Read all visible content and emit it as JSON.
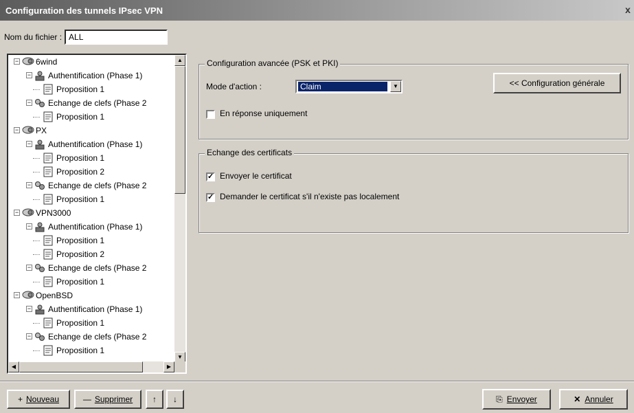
{
  "window": {
    "title": "Configuration des tunnels IPsec VPN",
    "close_glyph": "x"
  },
  "file": {
    "label": "Nom du fichier :",
    "value": "ALL"
  },
  "tree": {
    "items": [
      {
        "level": 0,
        "icon": "tunnel-icon",
        "label": "6wind"
      },
      {
        "level": 1,
        "icon": "auth-icon",
        "label": "Authentification (Phase 1)"
      },
      {
        "level": 2,
        "icon": "proposal-icon",
        "label": "Proposition 1"
      },
      {
        "level": 1,
        "icon": "key-exchange-icon",
        "label": "Echange de clefs (Phase 2"
      },
      {
        "level": 2,
        "icon": "proposal-icon",
        "label": "Proposition 1"
      },
      {
        "level": 0,
        "icon": "tunnel-icon",
        "label": "PX"
      },
      {
        "level": 1,
        "icon": "auth-icon",
        "label": "Authentification (Phase 1)"
      },
      {
        "level": 2,
        "icon": "proposal-icon",
        "label": "Proposition 1"
      },
      {
        "level": 2,
        "icon": "proposal-icon",
        "label": "Proposition 2"
      },
      {
        "level": 1,
        "icon": "key-exchange-icon",
        "label": "Echange de clefs (Phase 2"
      },
      {
        "level": 2,
        "icon": "proposal-icon",
        "label": "Proposition 1"
      },
      {
        "level": 0,
        "icon": "tunnel-icon",
        "label": "VPN3000"
      },
      {
        "level": 1,
        "icon": "auth-icon",
        "label": "Authentification (Phase 1)"
      },
      {
        "level": 2,
        "icon": "proposal-icon",
        "label": "Proposition 1"
      },
      {
        "level": 2,
        "icon": "proposal-icon",
        "label": "Proposition 2"
      },
      {
        "level": 1,
        "icon": "key-exchange-icon",
        "label": "Echange de clefs (Phase 2"
      },
      {
        "level": 2,
        "icon": "proposal-icon",
        "label": "Proposition 1"
      },
      {
        "level": 0,
        "icon": "tunnel-icon",
        "label": "OpenBSD"
      },
      {
        "level": 1,
        "icon": "auth-icon",
        "label": "Authentification (Phase 1)"
      },
      {
        "level": 2,
        "icon": "proposal-icon",
        "label": "Proposition 1"
      },
      {
        "level": 1,
        "icon": "key-exchange-icon",
        "label": "Echange de clefs (Phase 2"
      },
      {
        "level": 2,
        "icon": "proposal-icon",
        "label": "Proposition 1"
      }
    ]
  },
  "advanced": {
    "legend": "Configuration avancée (PSK et PKI)",
    "mode_label": "Mode d'action :",
    "mode_value": "Claim",
    "general_button": "<< Configuration générale",
    "responder_only_label": "En réponse uniquement",
    "responder_only_checked": false
  },
  "certificates": {
    "legend": "Echange des certificats",
    "send_cert_label": "Envoyer le certificat",
    "send_cert_checked": true,
    "request_cert_label": "Demander le certificat s'il n'existe pas localement",
    "request_cert_checked": true
  },
  "footer": {
    "new_button": "Nouveau",
    "delete_button": "Supprimer",
    "send_button": "Envoyer",
    "cancel_button": "Annuler"
  }
}
